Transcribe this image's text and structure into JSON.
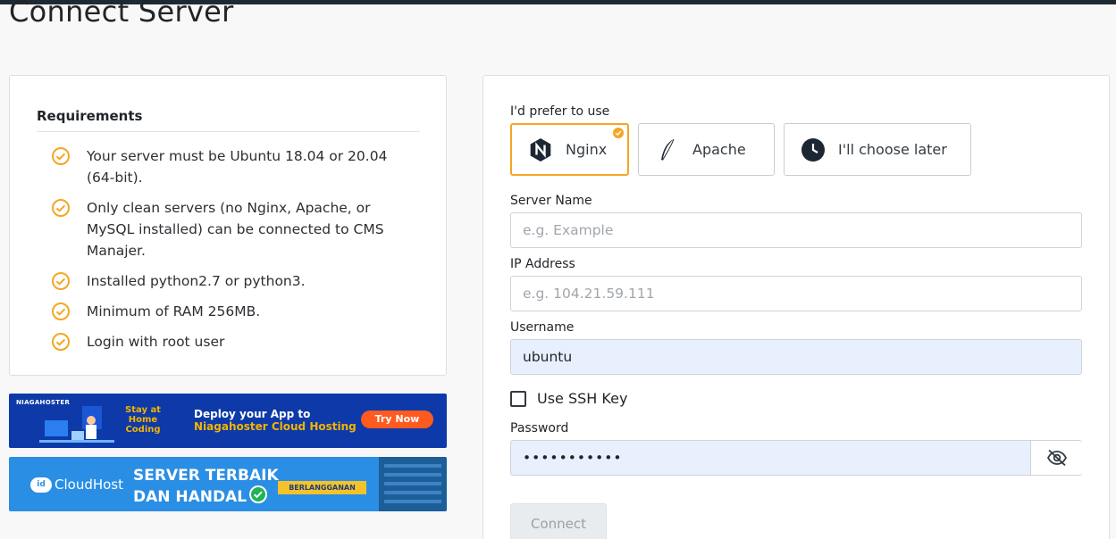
{
  "page": {
    "title": "Connect Server"
  },
  "requirements": {
    "title": "Requirements",
    "items": [
      "Your server must be Ubuntu 18.04 or 20.04 (64-bit).",
      "Only clean servers (no Nginx, Apache, or MySQL installed) can be connected to CMS Manajer.",
      "Installed python2.7 or python3.",
      "Minimum of RAM 256MB.",
      "Login with root user"
    ],
    "check_color": "#f5a623"
  },
  "banners": {
    "niagahoster": {
      "logo": "NIAGAHOSTER",
      "tagline": "Stay at Home Coding",
      "headline_1": "Deploy your App to",
      "headline_2": "Niagahoster Cloud Hosting",
      "cta": "Try Now"
    },
    "cloudhost": {
      "logo_id": "id",
      "logo": "CloudHost",
      "headline_1": "SERVER TERBAIK",
      "headline_2": "DAN HANDAL",
      "cta": "BERLANGGANAN"
    }
  },
  "form": {
    "prefer_label": "I'd prefer to use",
    "options": [
      {
        "label": "Nginx",
        "icon": "nginx-icon",
        "selected": true
      },
      {
        "label": "Apache",
        "icon": "apache-feather-icon",
        "selected": false
      },
      {
        "label": "I'll choose later",
        "icon": "clock-icon",
        "selected": false
      }
    ],
    "server_name": {
      "label": "Server Name",
      "placeholder": "e.g. Example",
      "value": ""
    },
    "ip_address": {
      "label": "IP Address",
      "placeholder": "e.g. 104.21.59.111",
      "value": ""
    },
    "username": {
      "label": "Username",
      "value": "ubuntu"
    },
    "ssh_key": {
      "label": "Use SSH Key",
      "checked": false
    },
    "password": {
      "label": "Password",
      "value": "•••••••••••"
    },
    "connect_label": "Connect",
    "accent": "#f5a623"
  }
}
